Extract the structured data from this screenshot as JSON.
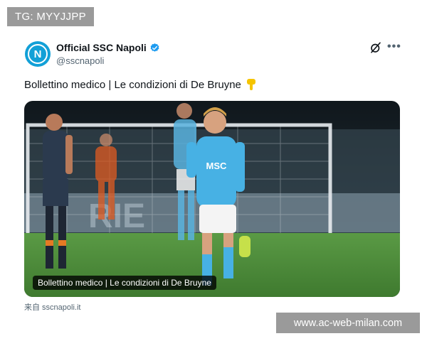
{
  "watermark_top": "TG: MYYJJPP",
  "post": {
    "display_name": "Official SSC Napoli",
    "handle": "@sscnapoli",
    "text": "Bollettino medico | Le condizioni di De Bruyne",
    "avatar_letter": "N",
    "icons": [
      "grok-icon",
      "more-icon",
      "verified-badge-icon",
      "pointing-down-icon"
    ],
    "media": {
      "caption": "Bollettino medico | Le condizioni di De Bruyne",
      "jersey_text": "MSC",
      "background_text": "RIE"
    }
  },
  "source": "来自 sscnapoli.it",
  "watermark_bottom": "www.ac-web-milan.com",
  "colors": {
    "napoli_blue": "#12a0d7",
    "verified_blue": "#1d9bf0",
    "pitch_green": "#4c8f3a"
  }
}
